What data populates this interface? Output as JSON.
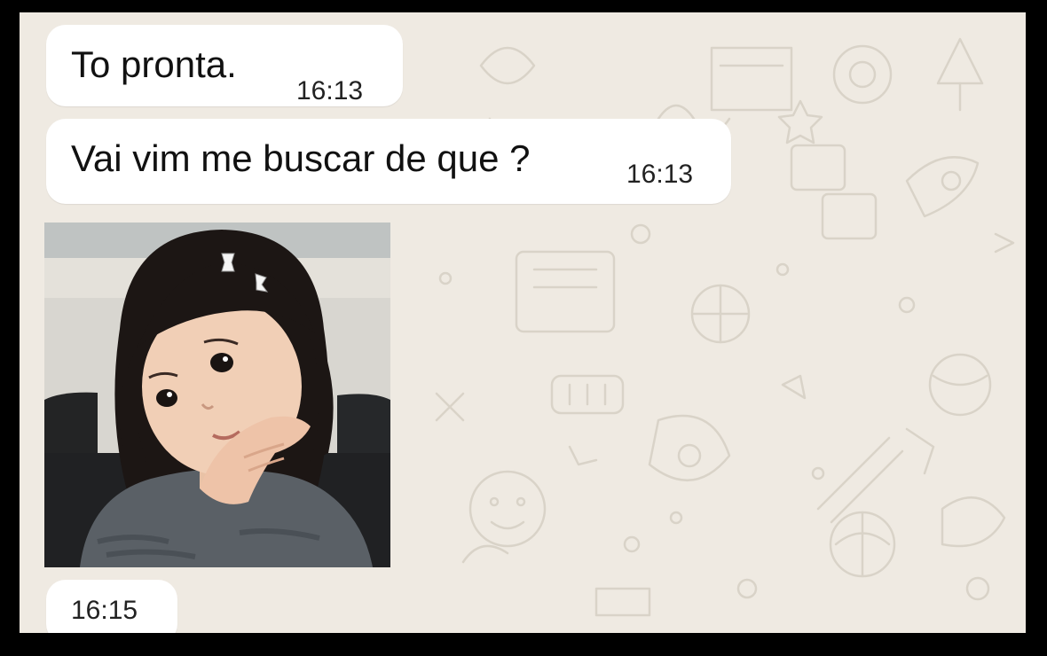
{
  "chat": {
    "messages": [
      {
        "text": "To pronta.",
        "time": "16:13"
      },
      {
        "text": "Vai vim me buscar de que ?",
        "time": "16:13"
      },
      {
        "image": "girl-photo",
        "time": "16:15"
      }
    ]
  },
  "colors": {
    "wallpaper": "#efeae2",
    "bubble": "#ffffff",
    "frame": "#000000"
  }
}
